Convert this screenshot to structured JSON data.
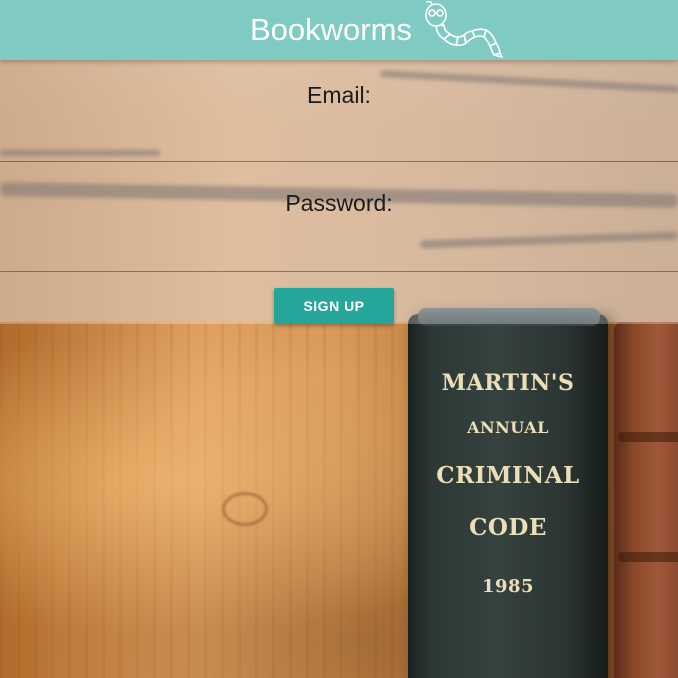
{
  "header": {
    "title": "Bookworms",
    "logo_icon": "bookworm-icon",
    "background": "#80cbc4"
  },
  "form": {
    "email_label": "Email:",
    "email_value": "",
    "password_label": "Password:",
    "password_value": "",
    "submit_label": "SIGN UP",
    "submit_color": "#26a69a"
  },
  "background_image": {
    "book_spine_lines": [
      "MARTIN'S",
      "ANNUAL",
      "CRIMINAL",
      "CODE",
      "1985"
    ]
  }
}
